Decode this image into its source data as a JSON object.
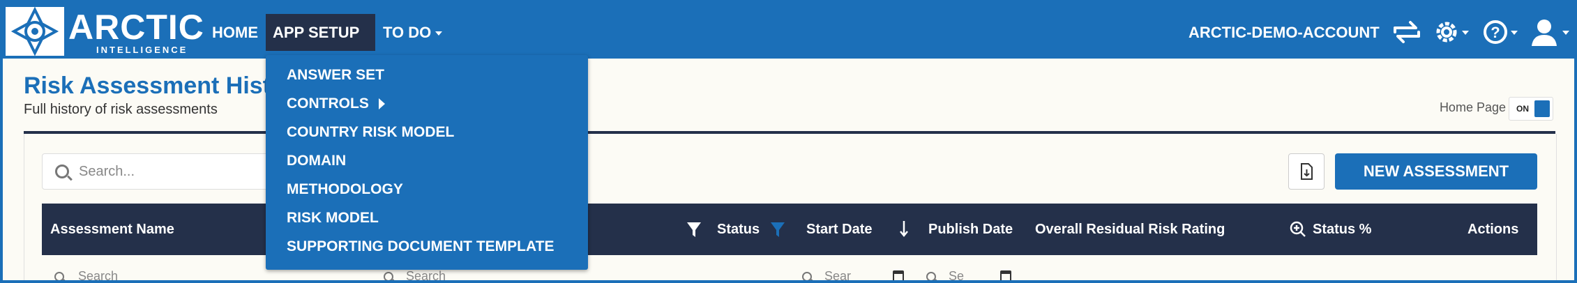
{
  "brand": {
    "name": "ARCTIC",
    "subtitle": "INTELLIGENCE"
  },
  "nav": {
    "home": "HOME",
    "app_setup": "APP SETUP",
    "todo": "TO DO",
    "account": "ARCTIC-DEMO-ACCOUNT"
  },
  "app_setup_menu": [
    "ANSWER SET",
    "CONTROLS",
    "COUNTRY RISK MODEL",
    "DOMAIN",
    "METHODOLOGY",
    "RISK MODEL",
    "SUPPORTING DOCUMENT TEMPLATE"
  ],
  "page": {
    "title": "Risk Assessment Hist",
    "subtitle": "Full history of risk assessments",
    "home_page_label": "Home Page",
    "toggle_state": "ON"
  },
  "toolbar": {
    "search_placeholder": "Search...",
    "new_assessment": "NEW ASSESSMENT"
  },
  "table": {
    "columns": {
      "name": "Assessment Name",
      "status": "Status",
      "start_date": "Start Date",
      "publish_date": "Publish Date",
      "overall_rating": "Overall Residual Risk Rating",
      "status_pct": "Status %",
      "actions": "Actions"
    },
    "filters": {
      "name": "Search",
      "col2": "Search",
      "start": "Sear",
      "publish": "Se"
    }
  },
  "colors": {
    "primary": "#1b6fb8",
    "dark": "#24304a",
    "background": "#fcfbf5"
  }
}
